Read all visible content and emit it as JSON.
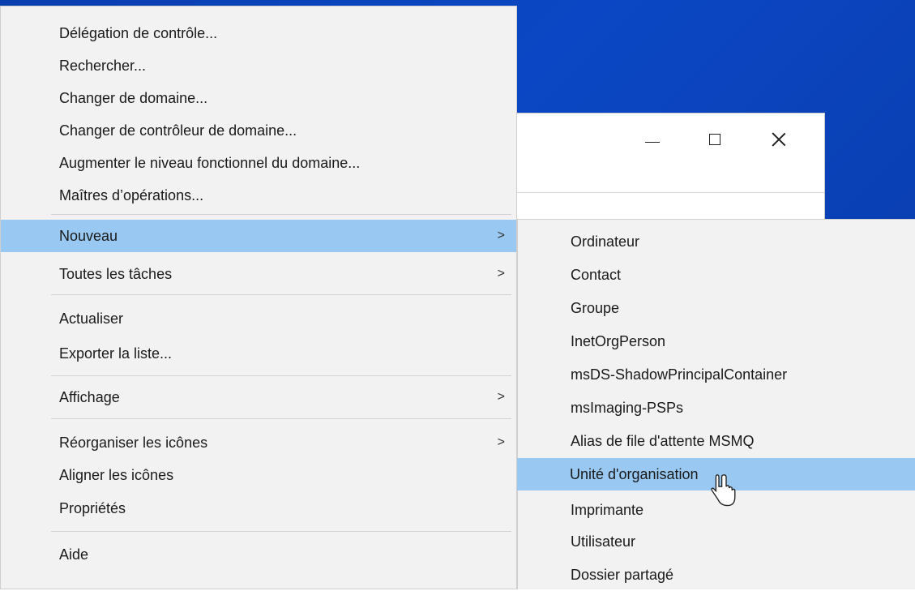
{
  "window_controls": {
    "minimize": "minimize-icon",
    "maximize": "maximize-icon",
    "close": "close-icon"
  },
  "main_menu": {
    "items": [
      {
        "label": "Délégation de contrôle..."
      },
      {
        "label": "Rechercher..."
      },
      {
        "label": "Changer de domaine..."
      },
      {
        "label": "Changer de contrôleur de domaine..."
      },
      {
        "label": "Augmenter le niveau fonctionnel du domaine..."
      },
      {
        "label": "Maîtres d’opérations..."
      },
      {
        "label": "Nouveau",
        "submenu": true,
        "selected": true
      },
      {
        "label": "Toutes les tâches",
        "submenu": true
      },
      {
        "label": "Actualiser"
      },
      {
        "label": "Exporter la liste..."
      },
      {
        "label": "Affichage",
        "submenu": true
      },
      {
        "label": "Réorganiser les icônes",
        "submenu": true
      },
      {
        "label": "Aligner les icônes"
      },
      {
        "label": "Propriétés"
      },
      {
        "label": "Aide"
      }
    ],
    "submenu_arrow": ">"
  },
  "submenu": {
    "items": [
      {
        "label": "Ordinateur"
      },
      {
        "label": "Contact"
      },
      {
        "label": "Groupe"
      },
      {
        "label": "InetOrgPerson"
      },
      {
        "label": "msDS-ShadowPrincipalContainer"
      },
      {
        "label": "msImaging-PSPs"
      },
      {
        "label": "Alias de file d'attente MSMQ"
      },
      {
        "label": "Unité d'organisation",
        "hovered": true
      },
      {
        "label": "Imprimante"
      },
      {
        "label": "Utilisateur"
      },
      {
        "label": "Dossier partagé"
      }
    ]
  },
  "colors": {
    "desktop": "#0b47c4",
    "menu_bg": "#f2f2f2",
    "highlight": "#99c9f2"
  }
}
